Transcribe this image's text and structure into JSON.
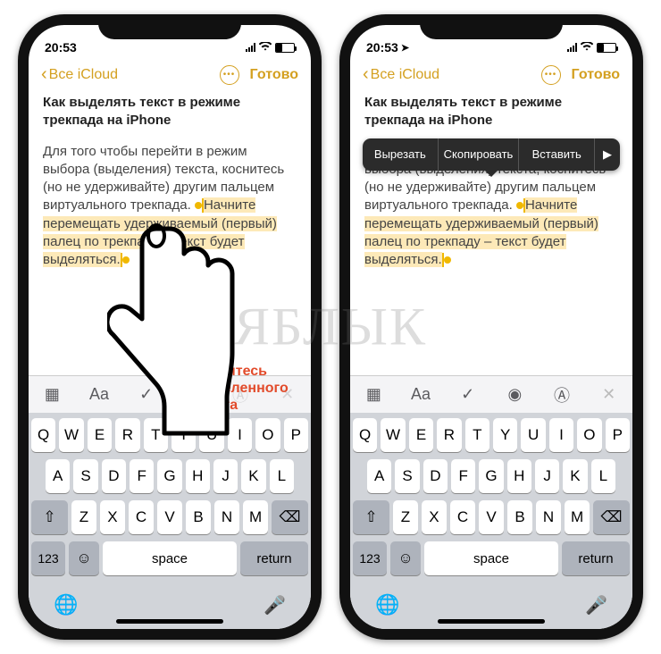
{
  "status": {
    "time": "20:53",
    "location_arrow": "➤"
  },
  "nav": {
    "back": "Все iCloud",
    "done": "Готово"
  },
  "note": {
    "title": "Как выделять текст в режиме трекпада на iPhone",
    "body_plain": "Для того чтобы перейти в режим выбора (выделения) текста, коснитесь (но не удерживайте) другим пальцем виртуального трекпада. ",
    "body_hl": "Начните перемещать удерживаемый (первый) палец по трекпаду – текст будет выделяться."
  },
  "context_menu": {
    "cut": "Вырезать",
    "copy": "Скопировать",
    "paste": "Вставить"
  },
  "annotation": {
    "line1": "Коснитесь",
    "line2": "выделенного",
    "line3": "текста"
  },
  "kb": {
    "row1": [
      "Q",
      "W",
      "E",
      "R",
      "T",
      "Y",
      "U",
      "I",
      "O",
      "P"
    ],
    "row2": [
      "A",
      "S",
      "D",
      "F",
      "G",
      "H",
      "J",
      "K",
      "L"
    ],
    "row3": [
      "Z",
      "X",
      "C",
      "V",
      "B",
      "N",
      "M"
    ],
    "n123": "123",
    "space": "space",
    "return": "return"
  },
  "watermark": "ЯБЛЫК"
}
